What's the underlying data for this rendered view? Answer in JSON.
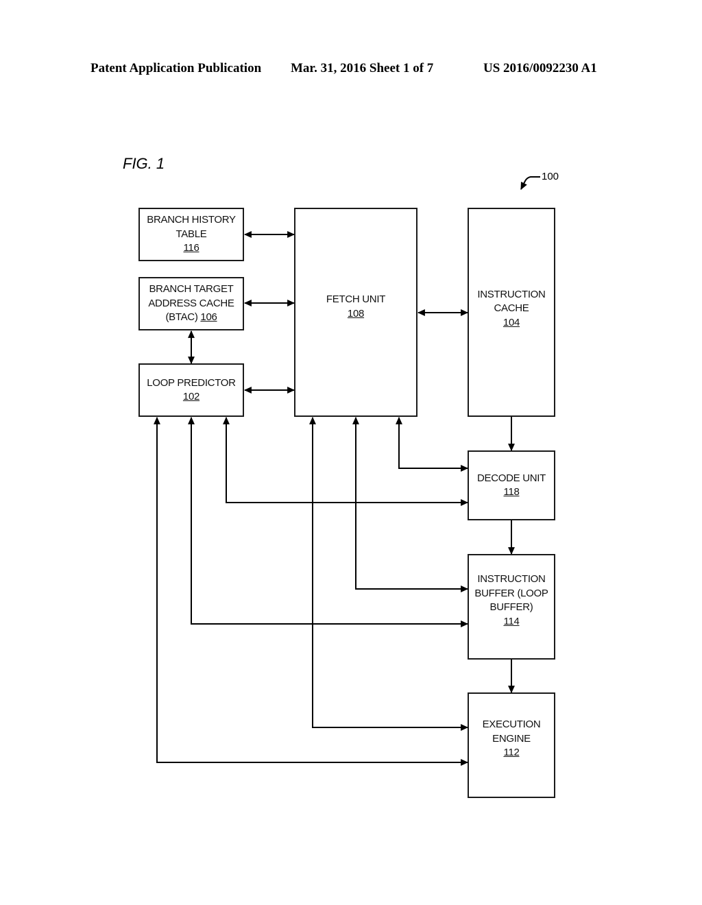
{
  "header": {
    "publication": "Patent Application Publication",
    "date_sheet": "Mar. 31, 2016  Sheet 1 of 7",
    "patent_number": "US 2016/0092230 A1"
  },
  "figure": {
    "label": "FIG. 1",
    "reference": "100"
  },
  "blocks": {
    "branch_history_table": {
      "lines": [
        "BRANCH HISTORY",
        "TABLE"
      ],
      "number": "116"
    },
    "btac": {
      "lines": [
        "BRANCH TARGET",
        "ADDRESS CACHE"
      ],
      "last_line_prefix": "(BTAC) ",
      "number": "106"
    },
    "loop_predictor": {
      "lines": [
        "LOOP PREDICTOR"
      ],
      "number": "102"
    },
    "fetch_unit": {
      "lines": [
        "FETCH UNIT"
      ],
      "number": "108"
    },
    "instruction_cache": {
      "lines": [
        "INSTRUCTION",
        "CACHE"
      ],
      "number": "104"
    },
    "decode_unit": {
      "lines": [
        "DECODE UNIT"
      ],
      "number": "118"
    },
    "instruction_buffer": {
      "lines": [
        "INSTRUCTION",
        "BUFFER (LOOP",
        "BUFFER)"
      ],
      "number": "114"
    },
    "execution_engine": {
      "lines": [
        "EXECUTION",
        "ENGINE"
      ],
      "number": "112"
    }
  },
  "connections": [
    {
      "from": "branch_history_table",
      "to": "fetch_unit",
      "direction": "bidirectional"
    },
    {
      "from": "btac",
      "to": "fetch_unit",
      "direction": "bidirectional"
    },
    {
      "from": "loop_predictor",
      "to": "fetch_unit",
      "direction": "bidirectional"
    },
    {
      "from": "btac",
      "to": "loop_predictor",
      "direction": "bidirectional"
    },
    {
      "from": "fetch_unit",
      "to": "instruction_cache",
      "direction": "bidirectional"
    },
    {
      "from": "instruction_cache",
      "to": "decode_unit",
      "direction": "forward"
    },
    {
      "from": "decode_unit",
      "to": "instruction_buffer",
      "direction": "forward"
    },
    {
      "from": "instruction_buffer",
      "to": "execution_engine",
      "direction": "forward"
    },
    {
      "from": "fetch_unit",
      "to": "decode_unit",
      "direction": "bidirectional"
    },
    {
      "from": "loop_predictor",
      "to": "decode_unit",
      "direction": "bidirectional"
    },
    {
      "from": "fetch_unit",
      "to": "instruction_buffer",
      "direction": "bidirectional"
    },
    {
      "from": "loop_predictor",
      "to": "instruction_buffer",
      "direction": "bidirectional"
    },
    {
      "from": "fetch_unit",
      "to": "execution_engine",
      "direction": "bidirectional"
    },
    {
      "from": "loop_predictor",
      "to": "execution_engine",
      "direction": "bidirectional"
    }
  ]
}
